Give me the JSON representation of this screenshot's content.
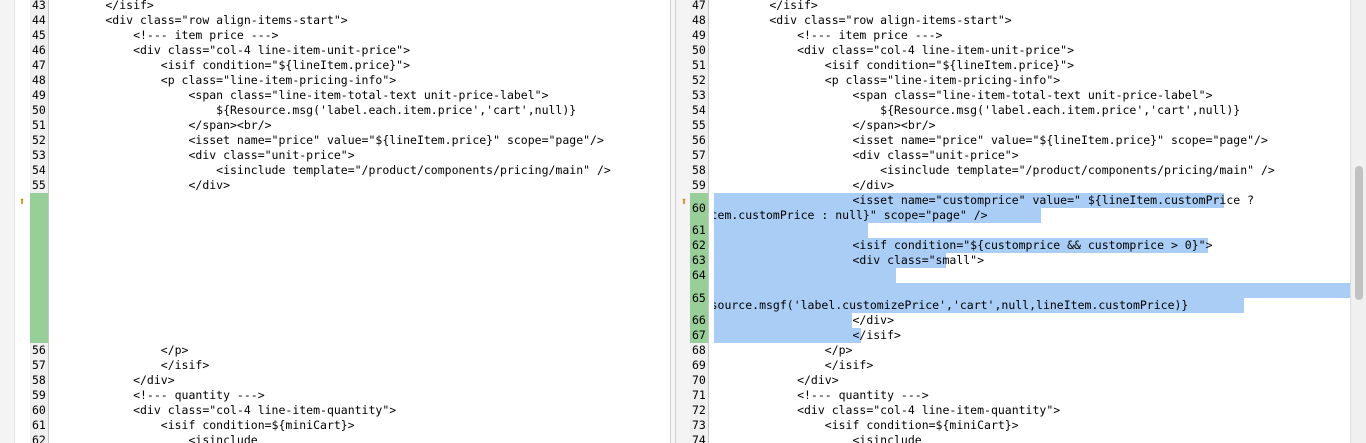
{
  "left_pane": {
    "lines": [
      {
        "num": "43",
        "text": "        </isif>"
      },
      {
        "num": "44",
        "text": "        <div class=\"row align-items-start\">"
      },
      {
        "num": "45",
        "text": "            <!--- item price --->"
      },
      {
        "num": "46",
        "text": "            <div class=\"col-4 line-item-unit-price\">"
      },
      {
        "num": "47",
        "text": "                <isif condition=\"${lineItem.price}\">"
      },
      {
        "num": "48",
        "text": "                <p class=\"line-item-pricing-info\">"
      },
      {
        "num": "49",
        "text": "                    <span class=\"line-item-total-text unit-price-label\">"
      },
      {
        "num": "50",
        "text": "                        ${Resource.msg('label.each.item.price','cart',null)}"
      },
      {
        "num": "51",
        "text": "                    </span><br/>"
      },
      {
        "num": "52",
        "text": "                    <isset name=\"price\" value=\"${lineItem.price}\" scope=\"page\"/>"
      },
      {
        "num": "53",
        "text": "                    <div class=\"unit-price\">"
      },
      {
        "num": "54",
        "text": "                        <isinclude template=\"/product/components/pricing/main\" />"
      },
      {
        "num": "55",
        "text": "                    </div>"
      }
    ],
    "lines_after": [
      {
        "num": "56",
        "text": "                </p>"
      },
      {
        "num": "57",
        "text": "                </isif>"
      },
      {
        "num": "58",
        "text": "            </div>"
      },
      {
        "num": "59",
        "text": "            <!--- quantity --->"
      },
      {
        "num": "60",
        "text": "            <div class=\"col-4 line-item-quantity\">"
      },
      {
        "num": "61",
        "text": "                <isif condition=${miniCart}>"
      },
      {
        "num": "62",
        "text": "                    <isinclude"
      }
    ]
  },
  "right_pane": {
    "lines_before": [
      {
        "num": "47",
        "text": "        </isif>"
      },
      {
        "num": "48",
        "text": "        <div class=\"row align-items-start\">"
      },
      {
        "num": "49",
        "text": "            <!--- item price --->"
      },
      {
        "num": "50",
        "text": "            <div class=\"col-4 line-item-unit-price\">"
      },
      {
        "num": "51",
        "text": "                <isif condition=\"${lineItem.price}\">"
      },
      {
        "num": "52",
        "text": "                <p class=\"line-item-pricing-info\">"
      },
      {
        "num": "53",
        "text": "                    <span class=\"line-item-total-text unit-price-label\">"
      },
      {
        "num": "54",
        "text": "                        ${Resource.msg('label.each.item.price','cart',null)}"
      },
      {
        "num": "55",
        "text": "                    </span><br/>"
      },
      {
        "num": "56",
        "text": "                    <isset name=\"price\" value=\"${lineItem.price}\" scope=\"page\"/>"
      },
      {
        "num": "57",
        "text": "                    <div class=\"unit-price\">"
      },
      {
        "num": "58",
        "text": "                        <isinclude template=\"/product/components/pricing/main\" />"
      },
      {
        "num": "59",
        "text": "                    </div>"
      }
    ],
    "added": [
      {
        "num": "60",
        "text": "                    <isset name=\"customprice\" value=\" ${lineItem.customPrice ?",
        "text2": "lineItem.customPrice : null}\" scope=\"page\" />"
      },
      {
        "num": "61",
        "text": ""
      },
      {
        "num": "62",
        "text": "                    <isif condition=\"${customprice && customprice > 0}\">"
      },
      {
        "num": "63",
        "text": "                    <div class=\"small\">"
      },
      {
        "num": "64",
        "text": "                        "
      },
      {
        "num": "65",
        "text": "",
        "text2": " ${Resource.msgf('label.customizePrice','cart',null,lineItem.customPrice)}"
      },
      {
        "num": "66",
        "text": "                    </div>"
      },
      {
        "num": "67",
        "text": "                    </isif>"
      }
    ],
    "lines_after": [
      {
        "num": "68",
        "text": "                </p>"
      },
      {
        "num": "69",
        "text": "                </isif>"
      },
      {
        "num": "70",
        "text": "            </div>"
      },
      {
        "num": "71",
        "text": "            <!--- quantity --->"
      },
      {
        "num": "72",
        "text": "            <div class=\"col-4 line-item-quantity\">"
      },
      {
        "num": "73",
        "text": "                <isif condition=${miniCart}>"
      },
      {
        "num": "74",
        "text": "                    <isinclude"
      }
    ]
  },
  "markers": {
    "icon": "change-arrow-icon",
    "glyph": "⬆",
    "color": "#e07b00"
  },
  "colors": {
    "added_bg": "#a9cdf5",
    "gutter_added": "#98cf98"
  }
}
